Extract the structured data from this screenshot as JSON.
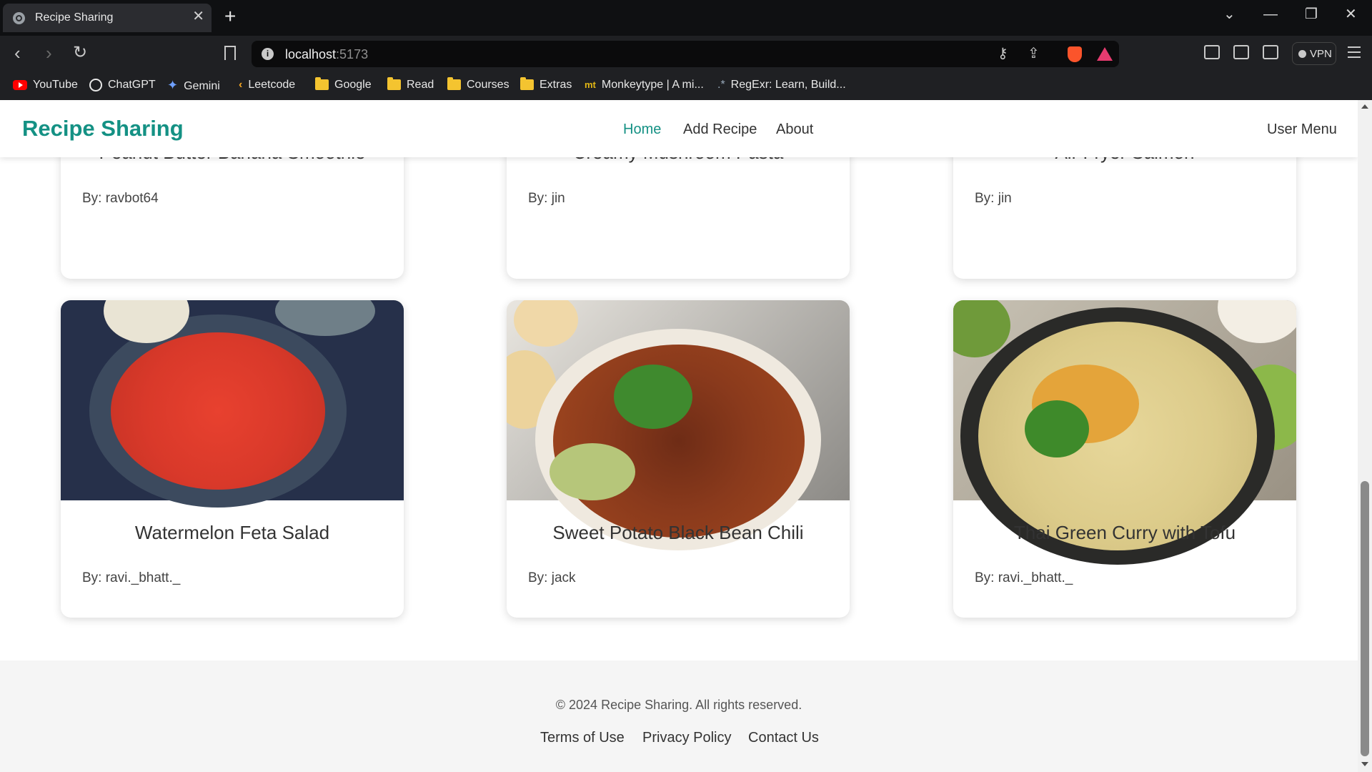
{
  "browser": {
    "tab_title": "Recipe Sharing",
    "tab_close": "✕",
    "new_tab": "+",
    "url_host": "localhost",
    "url_port": ":5173",
    "vpn_label": "VPN",
    "bookmarks": [
      {
        "label": "YouTube",
        "icon": "youtube-icon"
      },
      {
        "label": "ChatGPT",
        "icon": "chatgpt-icon"
      },
      {
        "label": "Gemini",
        "icon": "gemini-icon"
      },
      {
        "label": "Leetcode",
        "icon": "leetcode-icon"
      },
      {
        "label": "Google",
        "icon": "folder-icon"
      },
      {
        "label": "Read",
        "icon": "folder-icon"
      },
      {
        "label": "Courses",
        "icon": "folder-icon"
      },
      {
        "label": "Extras",
        "icon": "folder-icon"
      },
      {
        "label": "Monkeytype | A mi...",
        "icon": "monkeytype-icon"
      },
      {
        "label": "RegExr: Learn, Build...",
        "icon": "regexr-icon"
      }
    ]
  },
  "navbar": {
    "brand": "Recipe Sharing",
    "links": [
      {
        "label": "Home",
        "active": true
      },
      {
        "label": "Add Recipe",
        "active": false
      },
      {
        "label": "About",
        "active": false
      }
    ],
    "user_menu": "User Menu"
  },
  "recipes_top": [
    {
      "name": "Peanut Butter Banana Smoothie",
      "author": "By: ravbot64"
    },
    {
      "name": "Creamy Mushroom Pasta",
      "author": "By: jin"
    },
    {
      "name": "Air Fryer Salmon",
      "author": "By: jin"
    }
  ],
  "recipes": [
    {
      "name": "Watermelon Feta Salad",
      "author": "By: ravi._bhatt._"
    },
    {
      "name": "Sweet Potato Black Bean Chili",
      "author": "By: jack"
    },
    {
      "name": "Thai Green Curry with Tofu",
      "author": "By: ravi._bhatt._"
    }
  ],
  "footer": {
    "copyright": "© 2024 Recipe Sharing. All rights reserved.",
    "links": [
      "Terms of Use",
      "Privacy Policy",
      "Contact Us"
    ]
  },
  "colors": {
    "brand_teal": "#149184",
    "text_dark": "#333333",
    "footer_bg": "#f5f5f5"
  }
}
